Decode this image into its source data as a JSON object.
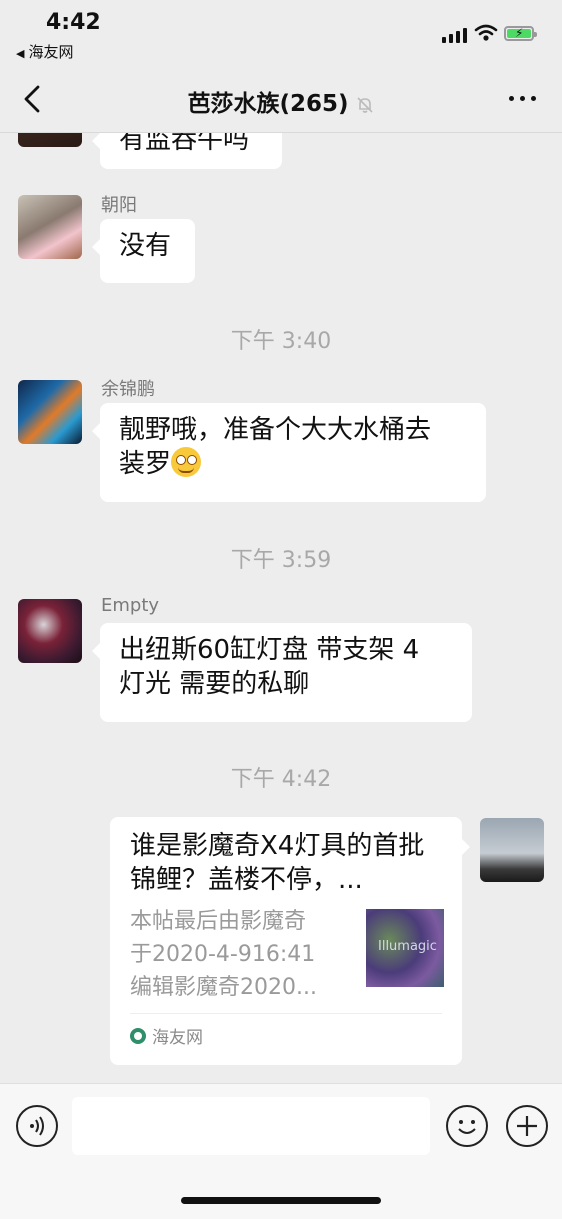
{
  "status": {
    "time": "4:42",
    "back_app": "海友网"
  },
  "nav": {
    "title": "芭莎水族(265)"
  },
  "messages": [
    {
      "id": "m0",
      "sender": "",
      "text": "有监吞牛吗"
    },
    {
      "id": "m1",
      "sender": "朝阳",
      "text": "没有"
    },
    {
      "id": "t1",
      "timestamp": "下午 3:40"
    },
    {
      "id": "m2",
      "sender": "余锦鹏",
      "text_line1": "靓野哦，准备个大大水桶去",
      "text_line2": "装罗"
    },
    {
      "id": "t2",
      "timestamp": "下午 3:59"
    },
    {
      "id": "m3",
      "sender": "Empty",
      "text_line1": "出纽斯60缸灯盘 带支架 4",
      "text_line2": "灯光 需要的私聊"
    },
    {
      "id": "t3",
      "timestamp": "下午 4:42"
    }
  ],
  "link_card": {
    "title": "谁是影魔奇X4灯具的首批锦鲤？盖楼不停，...",
    "desc_line1": "本帖最后由影魔奇",
    "desc_line2": "于2020-4-916:41",
    "desc_line3": "编辑影魔奇2020...",
    "thumb_watermark": "Illumagic",
    "source": "海友网"
  },
  "colors": {
    "bg": "#ededed",
    "bubble": "#ffffff",
    "source_icon": "#2f8f6b"
  },
  "icons": [
    "back-chevron-icon",
    "mute-bell-icon",
    "more-dots-icon",
    "voice-icon",
    "emoji-icon",
    "plus-icon"
  ]
}
